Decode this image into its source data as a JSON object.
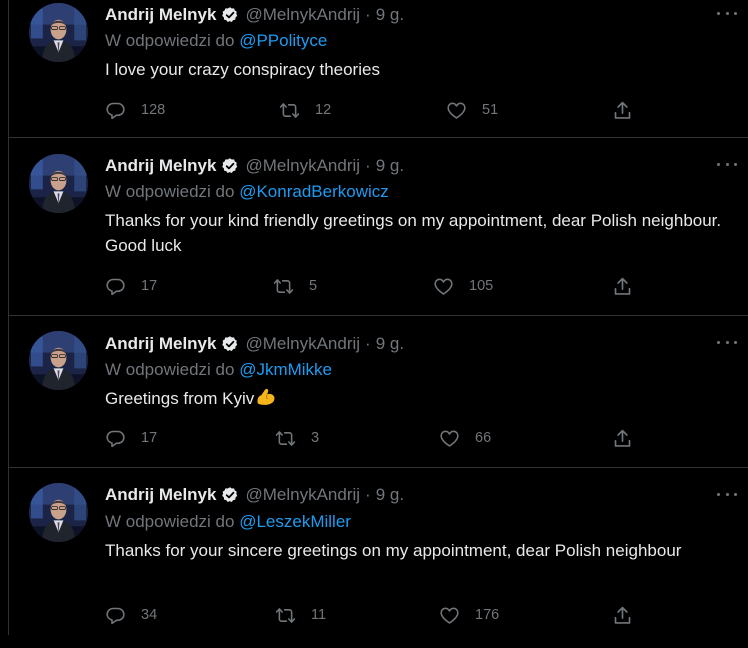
{
  "tweets": [
    {
      "name": "Andrij Melnyk",
      "handle": "@MelnykAndrij",
      "dot": "·",
      "time": "9 g.",
      "reply_prefix": "W odpowiedzi do",
      "reply_to": "@PPolityce",
      "text": "I love your crazy conspiracy theories",
      "replies": "128",
      "retweets": "12",
      "likes": "51"
    },
    {
      "name": "Andrij Melnyk",
      "handle": "@MelnykAndrij",
      "dot": "·",
      "time": "9 g.",
      "reply_prefix": "W odpowiedzi do",
      "reply_to": "@KonradBerkowicz",
      "text": "Thanks for your kind friendly greetings on my appointment, dear Polish neighbour. Good luck",
      "replies": "17",
      "retweets": "5",
      "likes": "105"
    },
    {
      "name": "Andrij Melnyk",
      "handle": "@MelnykAndrij",
      "dot": "·",
      "time": "9 g.",
      "reply_prefix": "W odpowiedzi do",
      "reply_to": "@JkmMikke",
      "text": "Greetings from Kyiv",
      "emoji": "flexed-biceps",
      "replies": "17",
      "retweets": "3",
      "likes": "66"
    },
    {
      "name": "Andrij Melnyk",
      "handle": "@MelnykAndrij",
      "dot": "·",
      "time": "9 g.",
      "reply_prefix": "W odpowiedzi do",
      "reply_to": "@LeszekMiller",
      "text": "Thanks for your sincere greetings on my appointment, dear Polish neighbour",
      "replies": "34",
      "retweets": "11",
      "likes": "176"
    }
  ],
  "colors": {
    "background": "#000000",
    "text_primary": "#e7e9ea",
    "text_secondary": "#71767b",
    "accent": "#1d9bf0",
    "divider": "#2f3336"
  }
}
